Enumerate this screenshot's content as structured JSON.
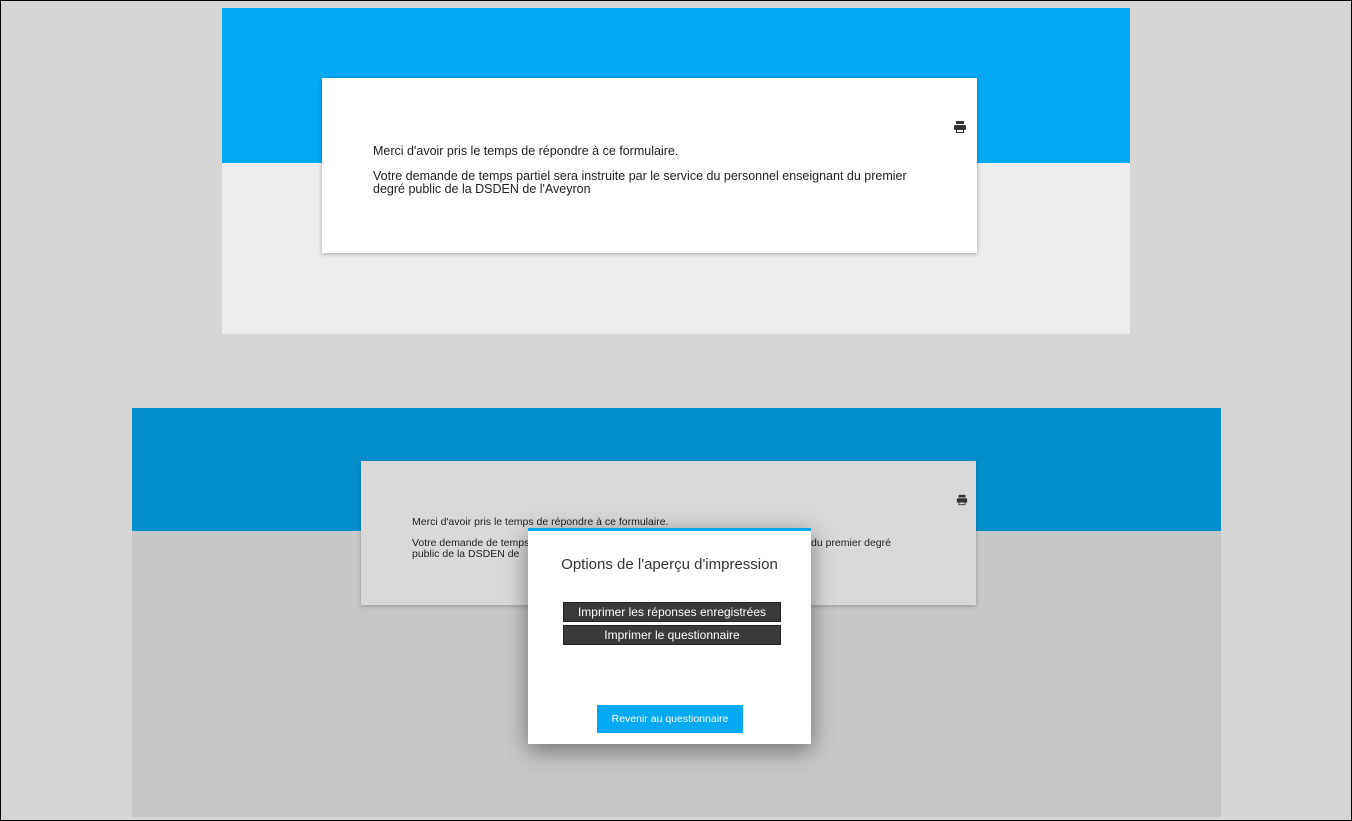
{
  "screens": {
    "before": {
      "thanks_message": "Merci d'avoir pris le temps de répondre à ce formulaire.",
      "info_message": "Votre demande de temps partiel sera instruite par le service du personnel enseignant du premier degré public de la DSDEN de l'Aveyron",
      "print_icon": "printer-icon"
    },
    "after": {
      "thanks_message": "Merci d'avoir pris le temps de répondre à ce formulaire.",
      "info_message_left": "Votre demande de temps",
      "info_message_left_2": "public de la DSDEN de",
      "info_message_right": "nt du premier degré",
      "print_icon": "printer-icon",
      "dialog": {
        "title": "Options de l'aperçu d'impression",
        "print_saved_label": "Imprimer les réponses enregistrées",
        "print_form_label": "Imprimer le questionnaire",
        "back_label": "Revenir au questionnaire"
      }
    }
  },
  "colors": {
    "accent": "#03a9f4",
    "accent_dimmed": "#0390cc",
    "dark_button": "#3a3a3a",
    "page_background": "#d6d6d6"
  }
}
